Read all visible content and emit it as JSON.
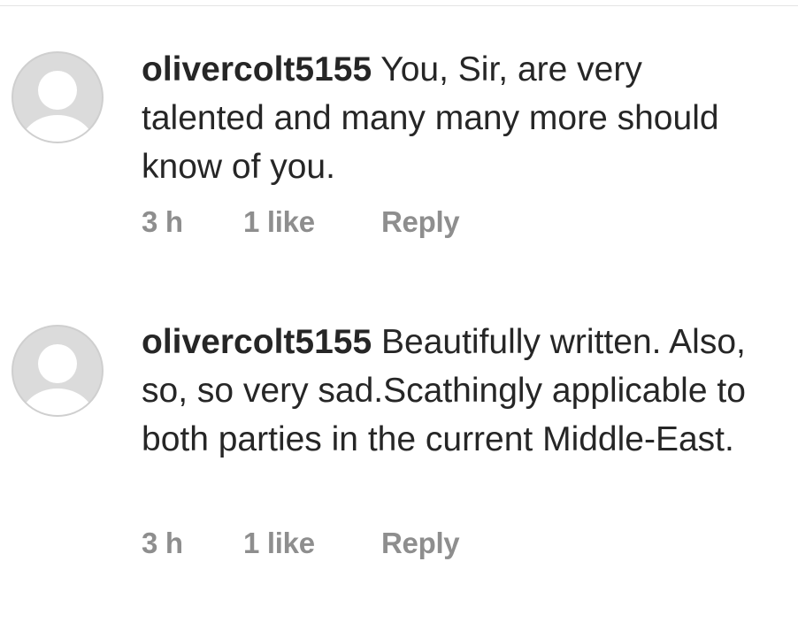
{
  "comments": [
    {
      "username": "olivercolt5155",
      "text": "You, Sir, are very talented and many many more should know of you.",
      "time": "3 h",
      "likes": "1 like",
      "reply_label": "Reply",
      "avatar_icon": "default-user-icon"
    },
    {
      "username": "olivercolt5155",
      "text": "Beautifully written. Also, so, so very sad.Scathingly applicable to both parties in the current Middle-East.",
      "time": "3 h",
      "likes": "1 like",
      "reply_label": "Reply",
      "avatar_icon": "default-user-icon"
    }
  ],
  "colors": {
    "text": "#262626",
    "meta": "#8e8e8e",
    "avatar_bg": "#dbdbdb"
  }
}
